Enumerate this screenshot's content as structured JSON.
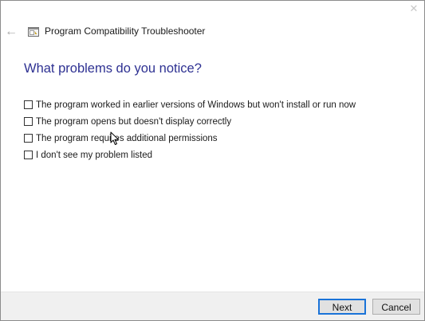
{
  "window": {
    "close_glyph": "✕"
  },
  "header": {
    "back_icon": "back-arrow-icon",
    "app_icon": "troubleshooter-icon",
    "title": "Program Compatibility Troubleshooter"
  },
  "main": {
    "heading": "What problems do you notice?",
    "options": [
      {
        "label": "The program worked in earlier versions of Windows but won't install or run now",
        "checked": false
      },
      {
        "label": "The program opens but doesn't display correctly",
        "checked": false
      },
      {
        "label": "The program requires additional permissions",
        "checked": false
      },
      {
        "label": "I don't see my problem listed",
        "checked": false
      }
    ]
  },
  "footer": {
    "next_label": "Next",
    "cancel_label": "Cancel"
  },
  "colors": {
    "heading": "#2e3192",
    "default_button_border": "#1a73d8",
    "footer_background": "#f0f0f0"
  }
}
